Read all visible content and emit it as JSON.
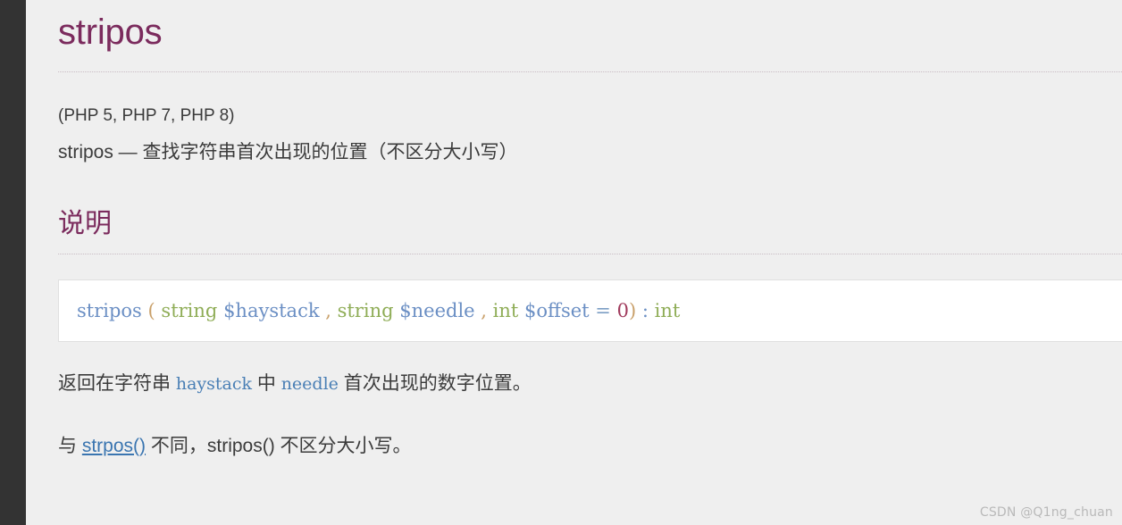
{
  "theme": {
    "page_background": "#efefef",
    "left_rail_color": "#333333",
    "heading_color": "#7b2b5d",
    "body_text_color": "#3b3b3b",
    "link_color": "#3a75b0",
    "code_background": "#ffffff",
    "code_border": "#e0e0e0",
    "watermark_color": "#b9b9b9"
  },
  "doc": {
    "title": "stripos",
    "version_info": "(PHP 5, PHP 7, PHP 8)",
    "purpose": "stripos — 查找字符串首次出现的位置（不区分大小写）",
    "section_title": "说明"
  },
  "synopsis": {
    "method_name": "stripos",
    "open_paren": "(",
    "params": [
      {
        "type": "string",
        "name": "$haystack",
        "separator": ","
      },
      {
        "type": "string",
        "name": "$needle",
        "separator": ","
      },
      {
        "type": "int",
        "name": "$offset",
        "equals": "=",
        "default": "0",
        "separator": ""
      }
    ],
    "close_paren": ")",
    "colon": ":",
    "return_type": "int",
    "full_text": "stripos ( string $haystack , string $needle , int $offset = 0 ) : int"
  },
  "paragraphs": {
    "p1": {
      "part1": "返回在字符串 ",
      "code1": "haystack",
      "part2": " 中 ",
      "code2": "needle",
      "part3": " 首次出现的数字位置。"
    },
    "p2": {
      "part1": "与 ",
      "link": "strpos()",
      "part2": " 不同，stripos() 不区分大小写。"
    }
  },
  "watermark": {
    "text": "CSDN @Q1ng_chuan"
  }
}
